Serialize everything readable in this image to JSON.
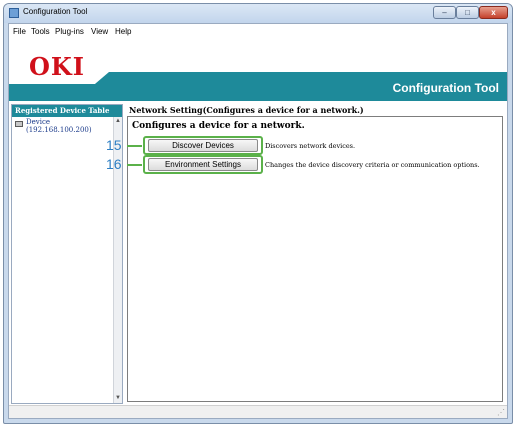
{
  "window": {
    "title": "Configuration Tool",
    "controls": {
      "minimize": "–",
      "maximize": "□",
      "close": "x"
    }
  },
  "menu": [
    "File",
    "Tools",
    "Plug-ins",
    "View",
    "Help"
  ],
  "brand": {
    "logo": "OKI",
    "app_title": "Configuration Tool",
    "accent_color": "#1e8a9a",
    "logo_color": "#d0101a"
  },
  "device_table": {
    "header": "Registered Device Table",
    "devices": [
      {
        "name": "Device",
        "address": "(192.168.100.200)",
        "icon": "printer-icon"
      }
    ]
  },
  "network": {
    "title": "Network Setting(Configures a device for a network.)",
    "heading": "Configures a device for a network.",
    "actions": [
      {
        "callout": "15",
        "label": "Discover Devices",
        "description": "Discovers network devices."
      },
      {
        "callout": "16",
        "label": "Environment Settings",
        "description": "Changes the device discovery criteria or communication options."
      }
    ]
  },
  "highlight_color": "#5bb14a",
  "callout_color": "#2e7fc4"
}
